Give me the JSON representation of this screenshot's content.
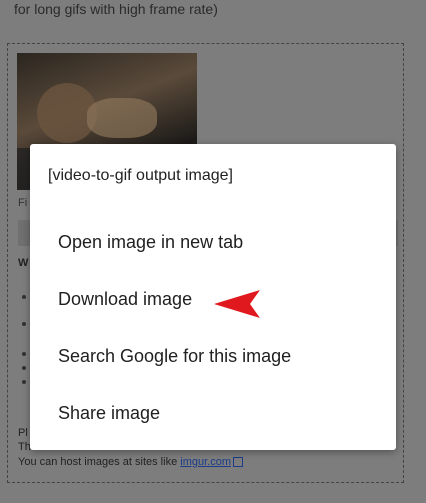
{
  "background": {
    "intro_line": "for long gifs with high frame rate)",
    "file_label_fragment": "Fi",
    "section_label_fragment": "W",
    "note_line_1_fragment": "Pl",
    "note_line_2_fragment": "Th",
    "hosting_text": "You can host images at sites like",
    "hosting_link": "imgur.com"
  },
  "dialog": {
    "title": "[video-to-gif output image]",
    "items": [
      {
        "label": "Open image in new tab"
      },
      {
        "label": "Download image"
      },
      {
        "label": "Search Google for this image"
      },
      {
        "label": "Share image"
      }
    ]
  },
  "colors": {
    "overlay": "#7d7d7d",
    "dialog_bg": "#ffffff",
    "arrow": "#e0191e",
    "link": "#1a3c8a"
  }
}
